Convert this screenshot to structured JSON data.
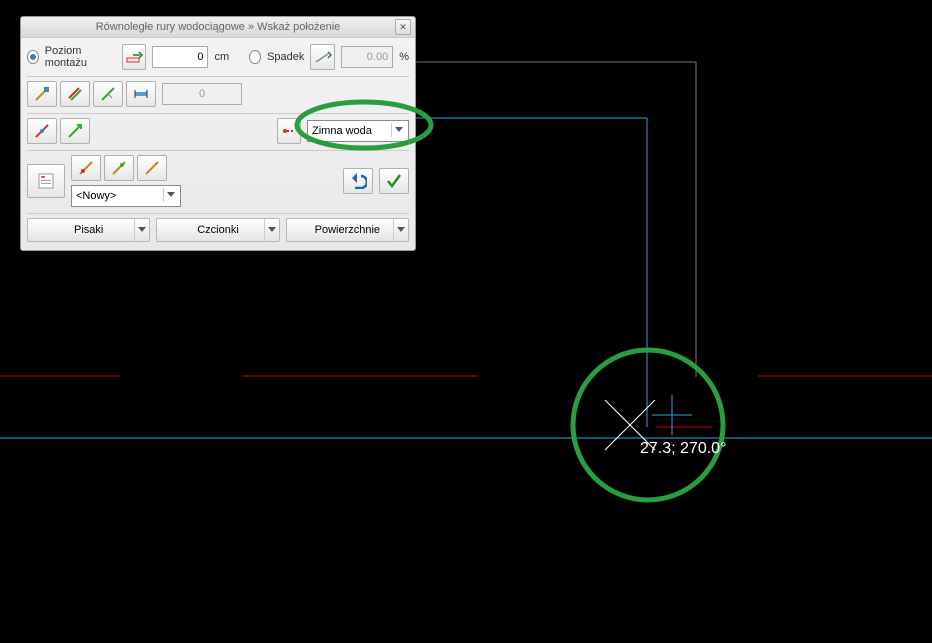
{
  "title": "Równoległe rury wodociągowe » Wskaż położenie",
  "row1": {
    "opt1": "Poziom montażu",
    "level_value": "0",
    "level_unit": "cm",
    "opt2": "Spadek",
    "slope_value": "0.00",
    "slope_unit": "%"
  },
  "row2": {
    "num_value": "0"
  },
  "pipe_type": {
    "selected": "Zimna woda"
  },
  "template": "<Nowy>",
  "buttons": {
    "b1": "Pisaki",
    "b2": "Czcionki",
    "b3": "Powierzchnie"
  },
  "cursor": "27.3;  270.0°",
  "colors": {
    "green": "#2a9d3f",
    "red": "#c00",
    "blue": "#3aa0d8"
  }
}
